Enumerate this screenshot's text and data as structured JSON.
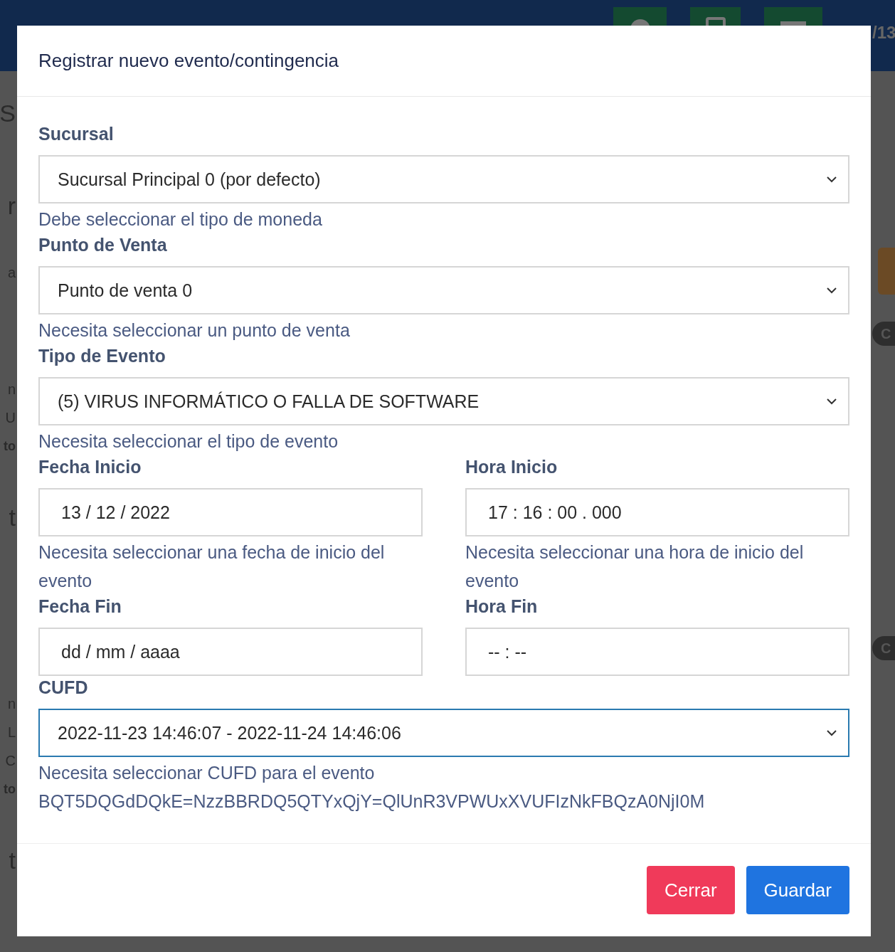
{
  "backdrop": {
    "page_number": "/13",
    "left_fragments": [
      {
        "text": "S",
        "kind": "large"
      },
      {
        "text": "r",
        "kind": "large"
      },
      {
        "text": "a",
        "kind": "plain"
      },
      {
        "text": "n",
        "kind": "plain"
      },
      {
        "text": "U",
        "kind": "plain"
      },
      {
        "text": "to",
        "kind": "bold"
      },
      {
        "text": "t",
        "kind": "large"
      },
      {
        "text": "n",
        "kind": "plain"
      },
      {
        "text": "L",
        "kind": "plain"
      },
      {
        "text": "C",
        "kind": "plain"
      },
      {
        "text": "to",
        "kind": "bold"
      },
      {
        "text": "t",
        "kind": "large"
      }
    ],
    "right_badges": [
      "C",
      "C"
    ]
  },
  "modal": {
    "title": "Registrar nuevo evento/contingencia",
    "fields": [
      {
        "kind": "select",
        "label": "Sucursal",
        "value": "Sucursal Principal 0 (por defecto)",
        "help": "Debe seleccionar el tipo de moneda",
        "focused": false
      },
      {
        "kind": "select",
        "label": "Punto de Venta",
        "value": "Punto de venta 0",
        "help": "Necesita seleccionar un punto de venta",
        "focused": false
      },
      {
        "kind": "select",
        "label": "Tipo de Evento",
        "value": "(5) VIRUS INFORMÁTICO O FALLA DE SOFTWARE",
        "help": "Necesita seleccionar el tipo de evento",
        "focused": false
      },
      {
        "kind": "pair",
        "items": [
          {
            "label": "Fecha Inicio",
            "value": "13 / 12 / 2022",
            "help": "Necesita seleccionar una fecha de inicio del evento"
          },
          {
            "label": "Hora Inicio",
            "value": "17 : 16 : 00 . 000",
            "help": "Necesita seleccionar una hora de inicio del evento"
          }
        ]
      },
      {
        "kind": "pair",
        "items": [
          {
            "label": "Fecha Fin",
            "placeholder": "dd / mm / aaaa"
          },
          {
            "label": "Hora Fin",
            "placeholder": "-- : --"
          }
        ]
      },
      {
        "kind": "select",
        "label": "CUFD",
        "value": "2022-11-23 14:46:07 - 2022-11-24 14:46:06",
        "help": "Necesita seleccionar CUFD para el evento",
        "focused": true
      }
    ],
    "code": "BQT5DQGdDQkE=NzzBBRDQ5QTYxQjY=QlUnR3VPWUxXVUFIzNkFBQzA0NjI0M",
    "buttons": [
      {
        "label": "Cerrar",
        "kind": "danger"
      },
      {
        "label": "Guardar",
        "kind": "primary"
      }
    ]
  }
}
